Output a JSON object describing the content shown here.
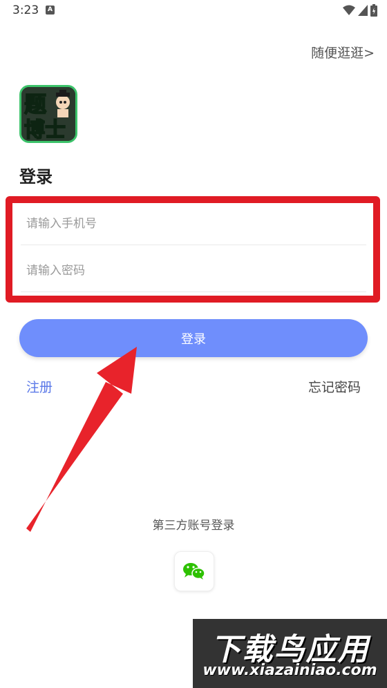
{
  "status_bar": {
    "time": "3:23",
    "notification_glyph": "A"
  },
  "top": {
    "browse_link": "随便逛逛>"
  },
  "logo": {
    "text_line1": "题",
    "text_line2": "博士"
  },
  "page": {
    "title": "登录"
  },
  "form": {
    "phone_placeholder": "请输入手机号",
    "password_placeholder": "请输入密码",
    "login_label": "登录"
  },
  "links": {
    "register": "注册",
    "forgot_password": "忘记密码"
  },
  "third_party": {
    "label": "第三方账号登录",
    "icon": "wechat-icon"
  },
  "watermark": {
    "main": "下载鸟应用",
    "url": "www.xiazainiao.com"
  },
  "colors": {
    "accent": "#6f8efc",
    "annotation": "#e01b24",
    "link": "#5a78e8"
  }
}
